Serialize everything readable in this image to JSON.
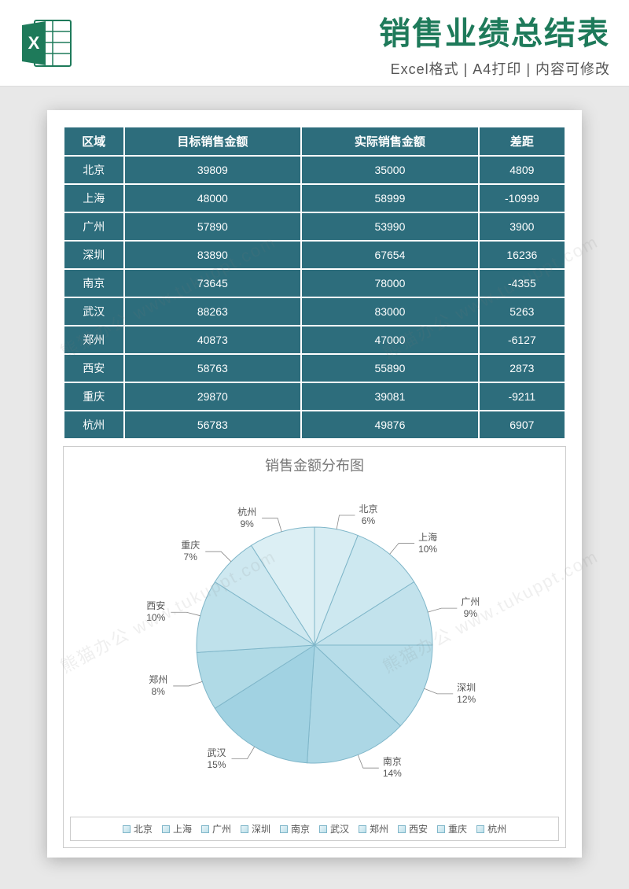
{
  "header": {
    "title": "销售业绩总结表",
    "subtitle": "Excel格式 | A4打印 | 内容可修改"
  },
  "table": {
    "headers": [
      "区域",
      "目标销售金额",
      "实际销售金额",
      "差距"
    ],
    "rows": [
      {
        "region": "北京",
        "target": "39809",
        "actual": "35000",
        "gap": "4809"
      },
      {
        "region": "上海",
        "target": "48000",
        "actual": "58999",
        "gap": "-10999"
      },
      {
        "region": "广州",
        "target": "57890",
        "actual": "53990",
        "gap": "3900"
      },
      {
        "region": "深圳",
        "target": "83890",
        "actual": "67654",
        "gap": "16236"
      },
      {
        "region": "南京",
        "target": "73645",
        "actual": "78000",
        "gap": "-4355"
      },
      {
        "region": "武汉",
        "target": "88263",
        "actual": "83000",
        "gap": "5263"
      },
      {
        "region": "郑州",
        "target": "40873",
        "actual": "47000",
        "gap": "-6127"
      },
      {
        "region": "西安",
        "target": "58763",
        "actual": "55890",
        "gap": "2873"
      },
      {
        "region": "重庆",
        "target": "29870",
        "actual": "39081",
        "gap": "-9211"
      },
      {
        "region": "杭州",
        "target": "56783",
        "actual": "49876",
        "gap": "6907"
      }
    ]
  },
  "chart_data": {
    "type": "pie",
    "title": "销售金额分布图",
    "series": [
      {
        "name": "北京",
        "value": 6,
        "label": "北京",
        "pct": "6%"
      },
      {
        "name": "上海",
        "value": 10,
        "label": "上海",
        "pct": "10%"
      },
      {
        "name": "广州",
        "value": 9,
        "label": "广州",
        "pct": "9%"
      },
      {
        "name": "深圳",
        "value": 12,
        "label": "深圳",
        "pct": "12%"
      },
      {
        "name": "南京",
        "value": 14,
        "label": "南京",
        "pct": "14%"
      },
      {
        "name": "武汉",
        "value": 15,
        "label": "武汉",
        "pct": "15%"
      },
      {
        "name": "郑州",
        "value": 8,
        "label": "郑州",
        "pct": "8%"
      },
      {
        "name": "西安",
        "value": 10,
        "label": "西安",
        "pct": "10%"
      },
      {
        "name": "重庆",
        "value": 7,
        "label": "重庆",
        "pct": "7%"
      },
      {
        "name": "杭州",
        "value": 9,
        "label": "杭州",
        "pct": "9%"
      }
    ],
    "legend": [
      "北京",
      "上海",
      "广州",
      "深圳",
      "南京",
      "武汉",
      "郑州",
      "西安",
      "重庆",
      "杭州"
    ]
  },
  "watermark": "熊猫办公 www.tukuppt.com"
}
